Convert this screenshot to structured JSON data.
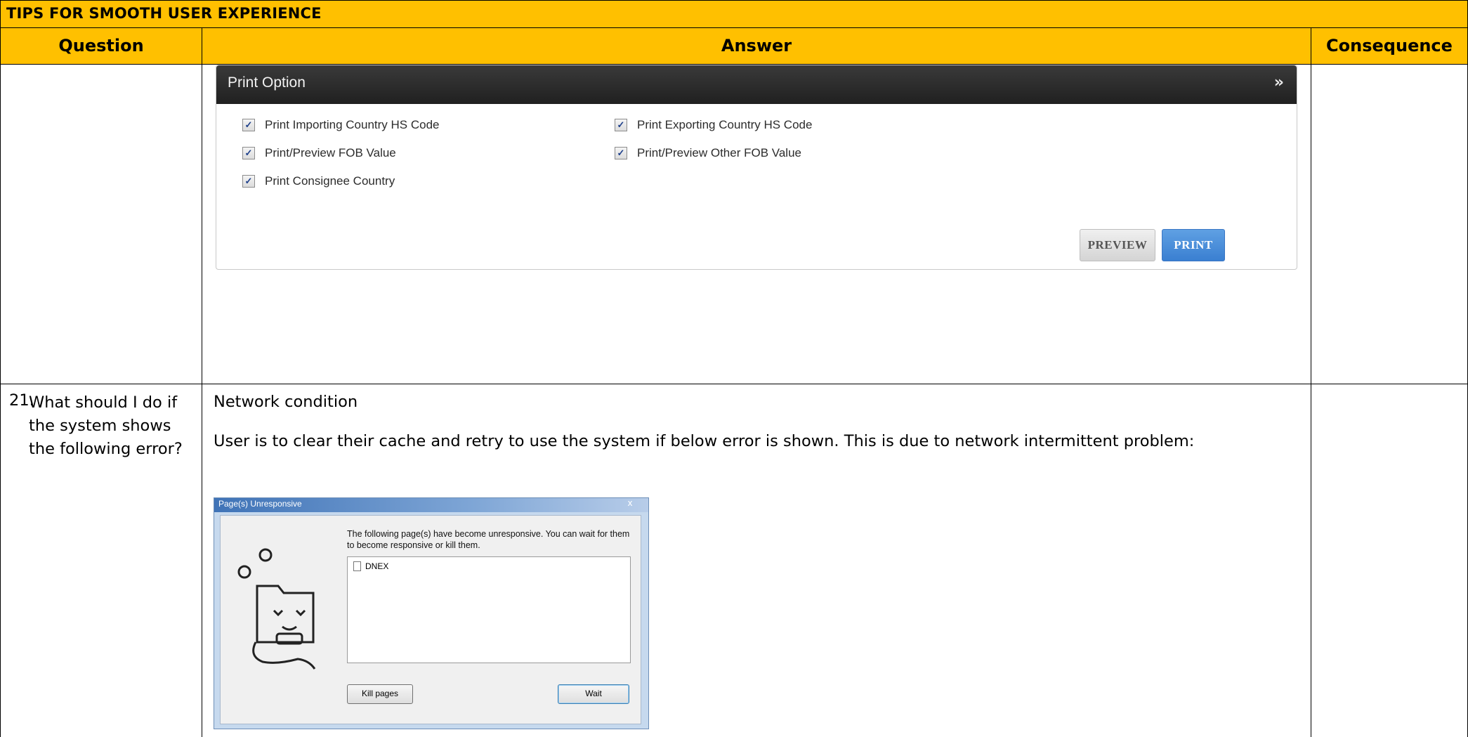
{
  "title": "TIPS FOR SMOOTH USER EXPERIENCE",
  "headers": {
    "question": "Question",
    "answer": "Answer",
    "consequence": "Consequence"
  },
  "print_panel": {
    "title": "Print Option",
    "options": [
      "Print Importing Country HS Code",
      "Print Exporting Country HS Code",
      "Print/Preview FOB Value",
      "Print/Preview Other FOB Value",
      "Print Consignee Country"
    ],
    "preview_label": "PREVIEW",
    "print_label": "PRINT"
  },
  "row2": {
    "question_number": "21.",
    "question_text": "What should I do if the system shows the following error?",
    "answer_title": "Network condition",
    "answer_text": "User is to clear their cache and retry to use the system if below error is shown. This is due to network intermittent problem:"
  },
  "dialog": {
    "title": "Page(s) Unresponsive",
    "close": "x",
    "message": "The following page(s) have become unresponsive. You can wait for them to become responsive or kill them.",
    "list_item": "DNEX",
    "kill_label": "Kill pages",
    "wait_label": "Wait"
  }
}
